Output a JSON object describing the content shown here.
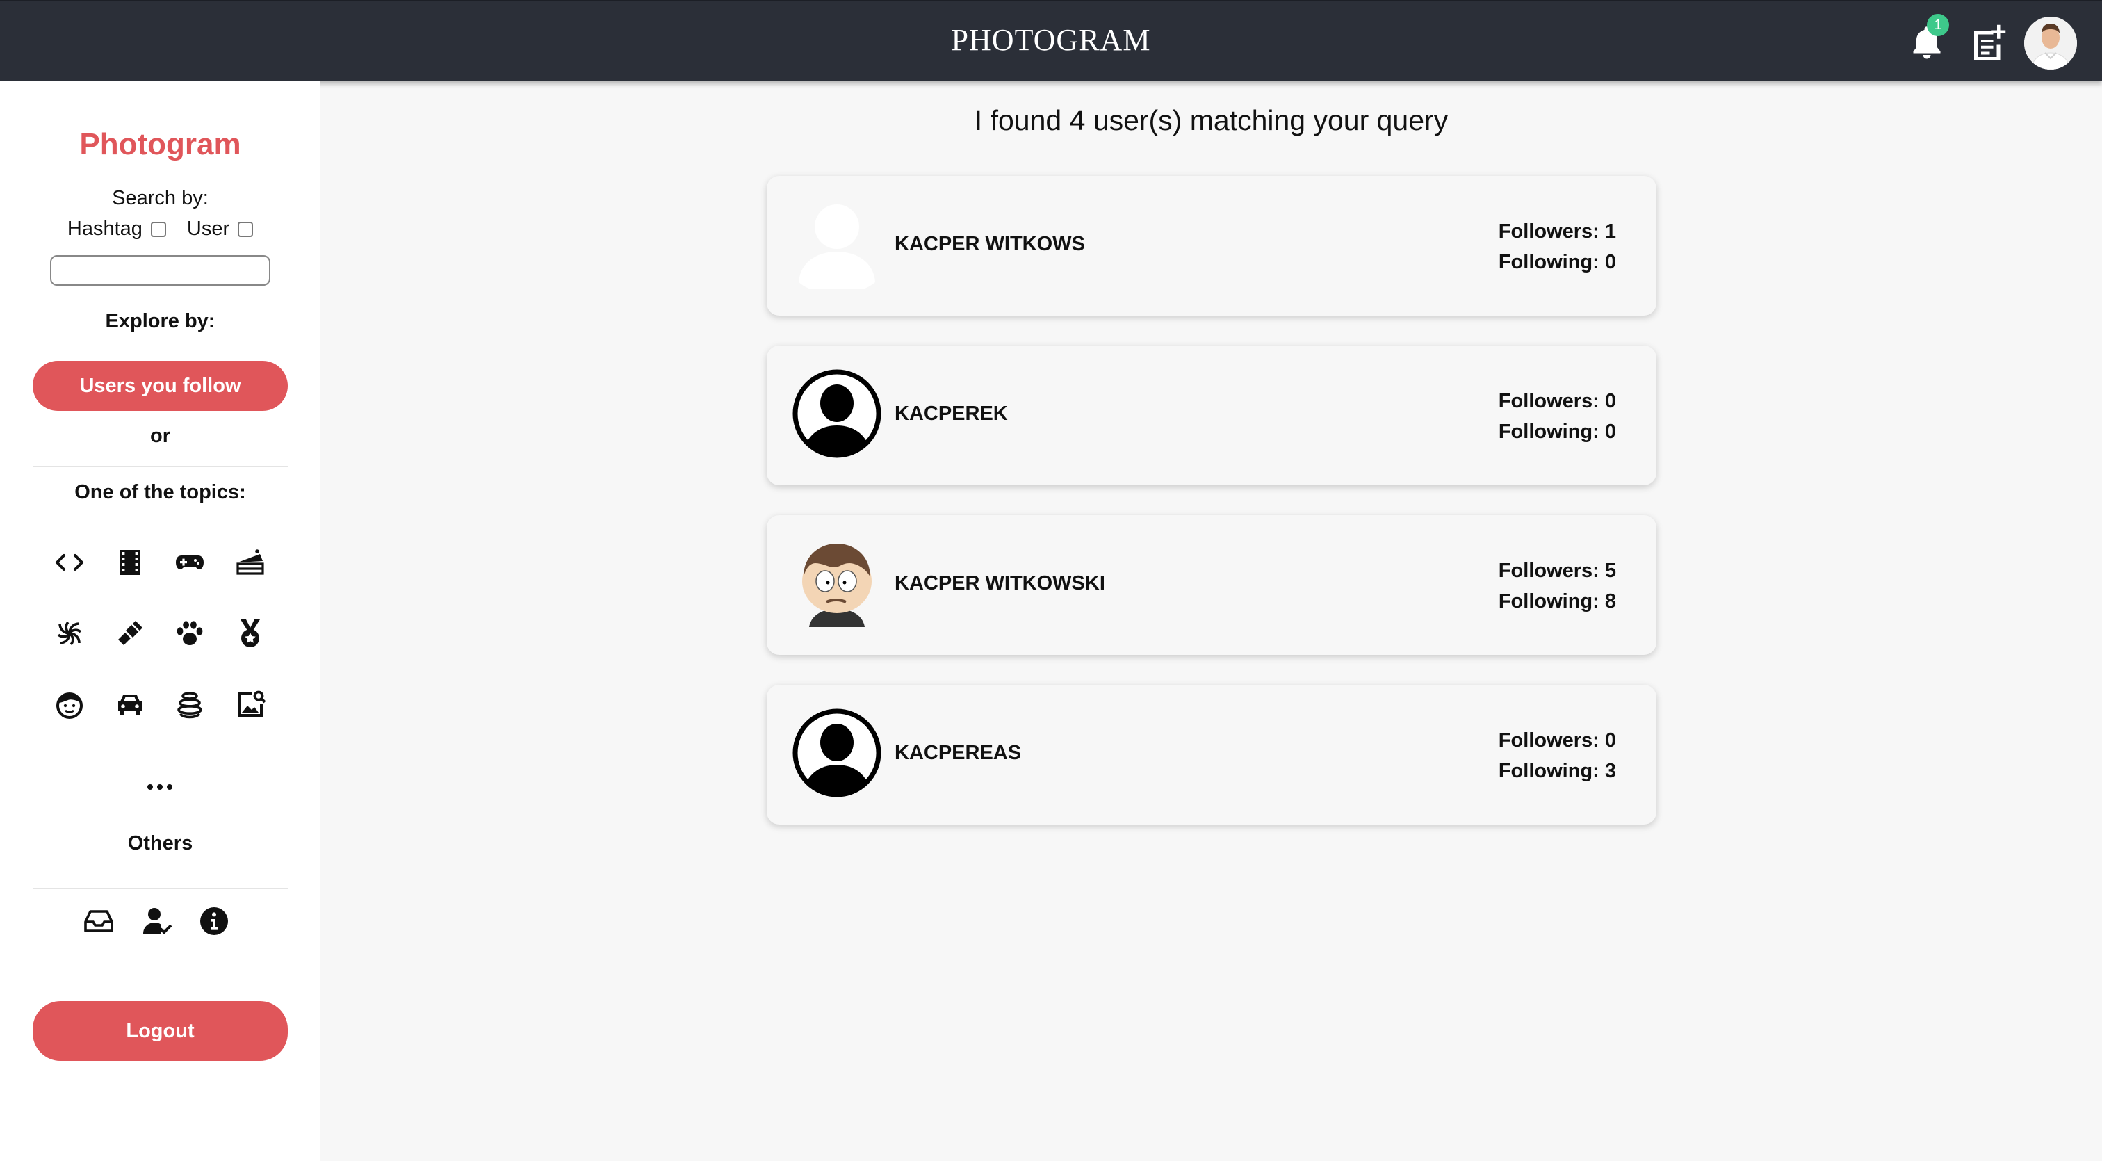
{
  "header": {
    "brand": "PHOTOGRAM",
    "notification_count": "1"
  },
  "sidebar": {
    "title": "Photogram",
    "search_by": "Search by:",
    "option_hashtag": "Hashtag",
    "option_user": "User",
    "search_value": "",
    "explore_by": "Explore by:",
    "users_follow_button": "Users you follow",
    "or": "or",
    "topics_title": "One of the topics:",
    "topics": [
      "code-icon",
      "film-icon",
      "gamepad-icon",
      "cake-icon",
      "spiral-icon",
      "lipstick-icon",
      "paw-icon",
      "medal-icon",
      "face-icon",
      "car-icon",
      "planet-icon",
      "image-search-icon"
    ],
    "more_label": "more-icon",
    "others_title": "Others",
    "others_icons": [
      "inbox-icon",
      "user-check-icon",
      "info-icon"
    ],
    "logout_button": "Logout"
  },
  "main": {
    "heading": "I found 4 user(s) matching your query",
    "results": [
      {
        "name": "KACPER WITKOWS",
        "followers": "Followers: 1",
        "following": "Following: 0",
        "avatar": "blank-avatar"
      },
      {
        "name": "KACPEREK",
        "followers": "Followers: 0",
        "following": "Following: 0",
        "avatar": "default-avatar"
      },
      {
        "name": "KACPER WITKOWSKI",
        "followers": "Followers: 5",
        "following": "Following: 8",
        "avatar": "cartoon-avatar"
      },
      {
        "name": "KACPEREAS",
        "followers": "Followers: 0",
        "following": "Following: 3",
        "avatar": "default-avatar"
      }
    ]
  },
  "colors": {
    "accent": "#e0565a",
    "topbar": "#2b2f38",
    "badge": "#3ec98b",
    "background": "#f7f7f7"
  }
}
